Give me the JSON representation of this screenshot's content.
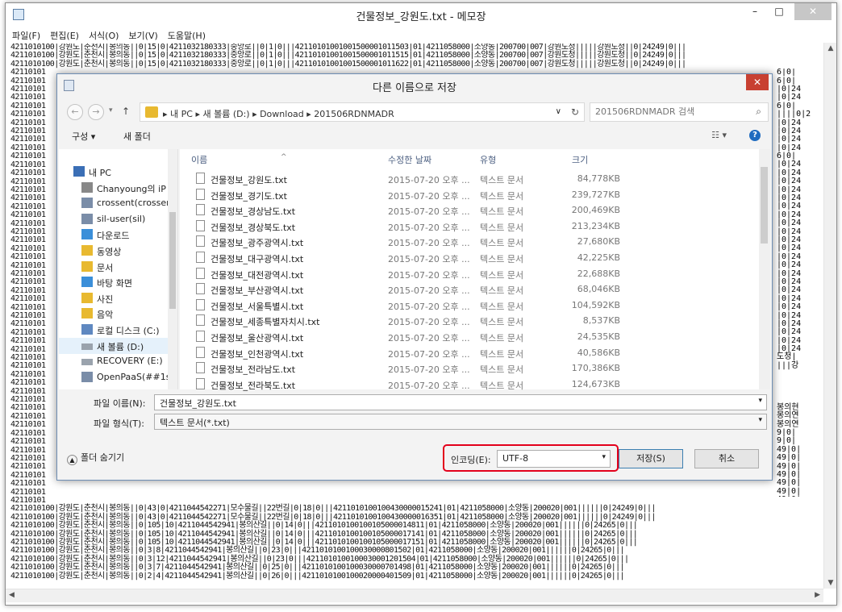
{
  "window": {
    "title": "건물정보_강원도.txt - 메모장",
    "min": "–",
    "max": "□",
    "close": "✕"
  },
  "menu": [
    "파일(F)",
    "편집(E)",
    "서식(O)",
    "보기(V)",
    "도움말(H)"
  ],
  "editor_lines": [
    "4211010100|강원도|춘천시|봉의동||0|15|0|4211032180333|중앙로||0|1|0|||42110101001001500001011503|01|4211058000|소양동|200700|007|강원도청|||||강원도청||0|24249|0|||",
    "4211010100|강원도|춘천시|봉의동||0|15|0|4211032180333|중앙로||0|1|0|||42110101001001500001011515|01|4211058000|소양동|200700|007|강원도청|||||강원도청||0|24249|0|||",
    "4211010100|강원도|춘천시|봉의동||0|15|0|4211032180333|중앙로||0|1|0|||42110101001001500001011622|01|4211058000|소양동|200700|007|강원도청|||||강원도청||0|24249|0|||",
    "42110101",
    "42110101",
    "42110101",
    "42110101",
    "42110101",
    "42110101",
    "42110101",
    "42110101",
    "42110101",
    "42110101",
    "42110101",
    "42110101",
    "42110101",
    "42110101",
    "42110101",
    "42110101",
    "42110101",
    "42110101",
    "42110101",
    "42110101",
    "42110101",
    "42110101",
    "42110101",
    "42110101",
    "42110101",
    "42110101",
    "42110101",
    "42110101",
    "42110101",
    "42110101",
    "42110101",
    "42110101",
    "42110101",
    "42110101",
    "42110101",
    "42110101",
    "42110101",
    "42110101",
    "42110101",
    "42110101",
    "42110101",
    "42110101",
    "42110101",
    "42110101",
    "42110101",
    "42110101",
    "42110101",
    "42110101",
    "42110101",
    "42110101",
    "42110101",
    "42110101",
    "4211010100|강원도|춘천시|봉의동||0|43|0|4211044542271|모수물길||22번길|0|18|0|||4211010100100430000015241|01|4211058000|소양동|200020|001||||||0|24249|0|||",
    "4211010100|강원도|춘천시|봉의동||0|43|0|4211044542271|모수물길||22번길|0|18|0|||4211010100100430000016351|01|4211058000|소양동|200020|001||||||0|24249|0|||",
    "4211010100|강원도|춘천시|봉의동||0|105|10|4211044542941|봉의산길||0|14|0|||4211010100100105000014811|01|4211058000|소양동|200020|001||||||0|24265|0|||",
    "4211010100|강원도|춘천시|봉의동||0|105|10|4211044542941|봉의산길||0|14|0|||4211010100100105000017141|01|4211058000|소양동|200020|001||||||0|24265|0|||",
    "4211010100|강원도|춘천시|봉의동||0|105|10|4211044542941|봉의산길||0|14|0|||4211010100100105000017151|01|4211058000|소양동|200020|001||||||0|24265|0|||",
    "4211010100|강원도|춘천시|봉의동||0|3|8|4211044542941|봉의산길||0|23|0|||4211010100100030000801502|01|4211058000|소양동|200020|001||||||0|24265|0|||",
    "4211010100|강원도|춘천시|봉의동||0|3|12|4211044542941|봉의산길||0|23|0|||4211010100100030001201504|01|4211058000|소양동|200020|001||||||0|24265|0|||",
    "4211010100|강원도|춘천시|봉의동||0|3|7|4211044542941|봉의산길||0|25|0|||4211010100100030000701498|01|4211058000|소양동|200020|001||||||0|24265|0|||",
    "4211010100|강원도|춘천시|봉의동||0|2|4|4211044542941|봉의산길||0|26|0|||4211010100100020000401509|01|4211058000|소양동|200020|001||||||0|24265|0|||"
  ],
  "editor_right_fragments": [
    "6|0|",
    "6|0|",
    "|0|24",
    "|0|24",
    "6|0|",
    "||||0|2",
    "|0|24",
    "|0|24",
    "|0|24",
    "|0|24",
    "6|0|",
    "|0|24",
    "|0|24",
    "|0|24",
    "|0|24",
    "|0|24",
    "|0|24",
    "|0|24",
    "|0|24",
    "|0|24",
    "|0|24",
    "|0|24",
    "|0|24",
    "|0|24",
    "|0|24",
    "|0|24",
    "|0|24",
    "|0|24",
    "|0|24",
    "|0|24",
    "|0|24",
    "|0|24",
    "|0|24",
    "|0|24",
    "도청|",
    "|||강",
    "",
    "",
    "",
    "",
    "봉의현",
    "봉의연",
    "봉의연",
    "9|0|",
    "9|0|",
    "49|0|",
    "49|0|",
    "49|0|",
    "49|0|",
    "49|0|",
    "49|0|",
    "49|0|",
    "49|0|",
    "49|0|",
    "49|1|"
  ],
  "dialog": {
    "title": "다른 이름으로 저장",
    "close": "✕",
    "back": "←",
    "forward": "→",
    "up": "↑",
    "breadcrumbs": "▸ 내 PC  ▸ 새 볼륨 (D:)  ▸ Download  ▸ 201506RDNMADR",
    "address_dd": "∨",
    "refresh": "↻",
    "search_placeholder": "201506RDNMADR 검색",
    "search_icon": "⌕",
    "organize": "구성 ▾",
    "new_folder": "새 폴더",
    "view_icon": "☷ ▾",
    "help": "?",
    "nav": [
      {
        "label": "내 PC",
        "icon": "pc-icon",
        "indent": 0
      },
      {
        "label": "Chanyoung의 iP",
        "icon": "device-icon",
        "indent": 1
      },
      {
        "label": "crossent(crossen",
        "icon": "network-drive-icon",
        "indent": 1
      },
      {
        "label": "sil-user(sil)",
        "icon": "network-drive-icon",
        "indent": 1
      },
      {
        "label": "다운로드",
        "icon": "download-folder-icon",
        "indent": 1
      },
      {
        "label": "동영상",
        "icon": "video-folder-icon",
        "indent": 1
      },
      {
        "label": "문서",
        "icon": "documents-folder-icon",
        "indent": 1
      },
      {
        "label": "바탕 화면",
        "icon": "desktop-folder-icon",
        "indent": 1
      },
      {
        "label": "사진",
        "icon": "pictures-folder-icon",
        "indent": 1
      },
      {
        "label": "음악",
        "icon": "music-folder-icon",
        "indent": 1
      },
      {
        "label": "로컬 디스크 (C:)",
        "icon": "local-disk-icon",
        "indent": 1
      },
      {
        "label": "새 볼륨 (D:)",
        "icon": "drive-icon",
        "indent": 1,
        "selected": true
      },
      {
        "label": "RECOVERY (E:)",
        "icon": "drive-icon",
        "indent": 1
      },
      {
        "label": "OpenPaaS(##1s",
        "icon": "network-drive-icon",
        "indent": 1
      }
    ],
    "columns": {
      "name": "이름",
      "date": "수정한 날짜",
      "type": "유형",
      "size": "크기"
    },
    "files": [
      {
        "name": "건물정보_강원도.txt",
        "date": "2015-07-20 오후 ...",
        "type": "텍스트 문서",
        "size": "84,778KB"
      },
      {
        "name": "건물정보_경기도.txt",
        "date": "2015-07-20 오후 ...",
        "type": "텍스트 문서",
        "size": "239,727KB"
      },
      {
        "name": "건물정보_경상남도.txt",
        "date": "2015-07-20 오후 ...",
        "type": "텍스트 문서",
        "size": "200,469KB"
      },
      {
        "name": "건물정보_경상북도.txt",
        "date": "2015-07-20 오후 ...",
        "type": "텍스트 문서",
        "size": "213,234KB"
      },
      {
        "name": "건물정보_광주광역시.txt",
        "date": "2015-07-20 오후 ...",
        "type": "텍스트 문서",
        "size": "27,680KB"
      },
      {
        "name": "건물정보_대구광역시.txt",
        "date": "2015-07-20 오후 ...",
        "type": "텍스트 문서",
        "size": "42,225KB"
      },
      {
        "name": "건물정보_대전광역시.txt",
        "date": "2015-07-20 오후 ...",
        "type": "텍스트 문서",
        "size": "22,688KB"
      },
      {
        "name": "건물정보_부산광역시.txt",
        "date": "2015-07-20 오후 ...",
        "type": "텍스트 문서",
        "size": "68,046KB"
      },
      {
        "name": "건물정보_서울특별시.txt",
        "date": "2015-07-20 오후 ...",
        "type": "텍스트 문서",
        "size": "104,592KB"
      },
      {
        "name": "건물정보_세종특별자치시.txt",
        "date": "2015-07-20 오후 ...",
        "type": "텍스트 문서",
        "size": "8,537KB"
      },
      {
        "name": "건물정보_울산광역시.txt",
        "date": "2015-07-20 오후 ...",
        "type": "텍스트 문서",
        "size": "24,535KB"
      },
      {
        "name": "건물정보_인천광역시.txt",
        "date": "2015-07-20 오후 ...",
        "type": "텍스트 문서",
        "size": "40,586KB"
      },
      {
        "name": "건물정보_전라남도.txt",
        "date": "2015-07-20 오후 ...",
        "type": "텍스트 문서",
        "size": "170,386KB"
      },
      {
        "name": "건물정보_전라북도.txt",
        "date": "2015-07-20 오후 ...",
        "type": "텍스트 문서",
        "size": "124,673KB"
      }
    ],
    "filename_label": "파일 이름(N):",
    "filename_value": "건물정보_강원도.txt",
    "filetype_label": "파일 형식(T):",
    "filetype_value": "텍스트 문서(*.txt)",
    "hide_folders": "폴더 숨기기",
    "encoding_label": "인코딩(E):",
    "encoding_value": "UTF-8",
    "save": "저장(S)",
    "cancel": "취소",
    "dd": "▾"
  },
  "colors": {
    "highlight": "#e3001b",
    "close_red": "#c84031",
    "selection": "#e5f1fb"
  }
}
